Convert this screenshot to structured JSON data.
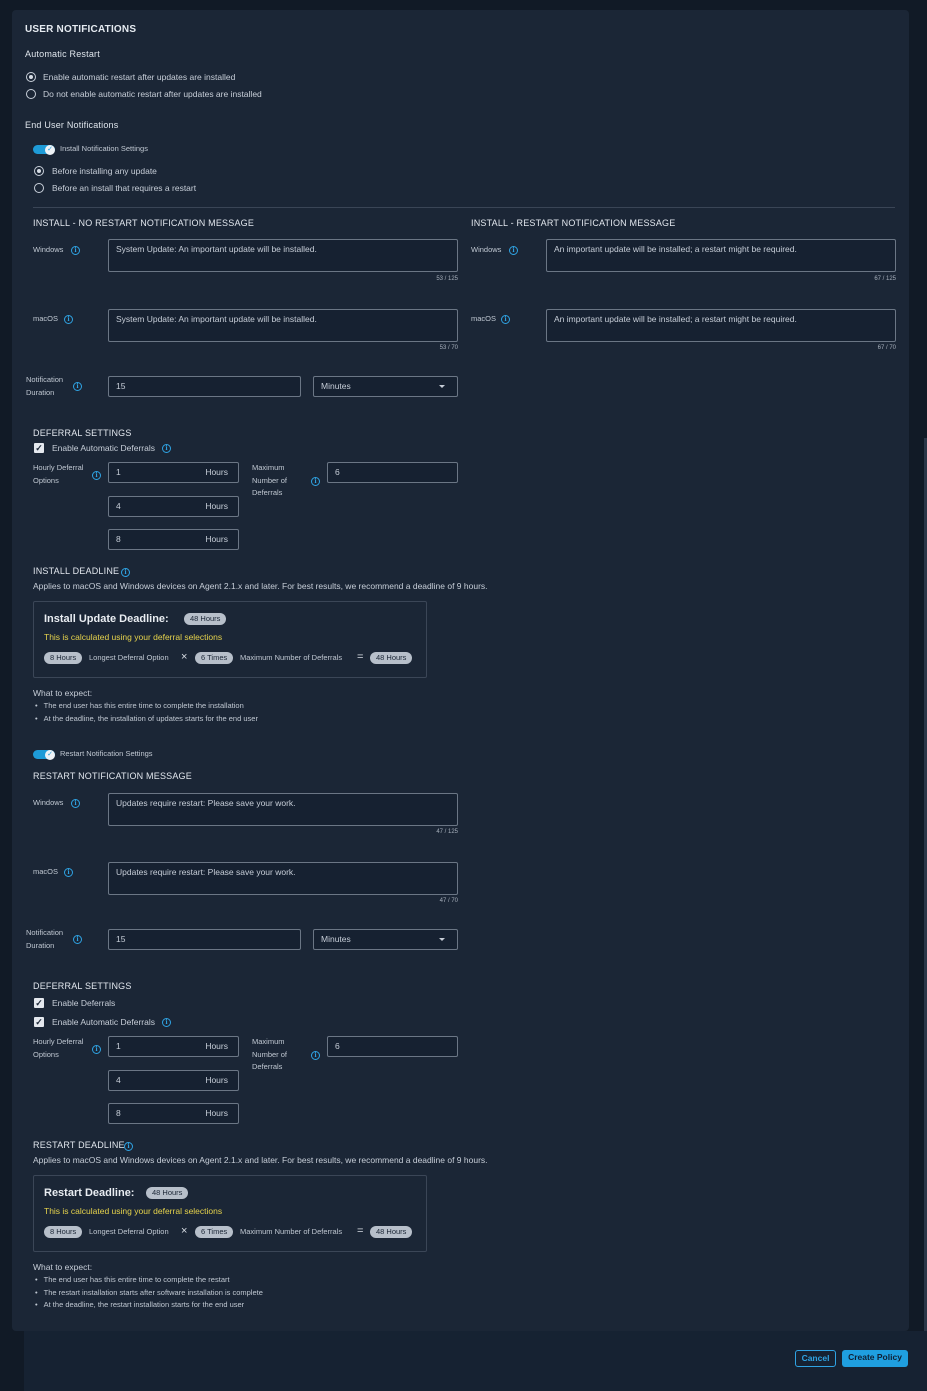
{
  "title": "USER NOTIFICATIONS",
  "automatic_restart": {
    "heading": "Automatic Restart",
    "options": [
      "Enable automatic restart after updates are installed",
      "Do not enable automatic restart after updates are installed"
    ],
    "selected_index": 0
  },
  "end_user": {
    "heading": "End User Notifications",
    "install_toggle_label": "Install Notification Settings",
    "install_toggle_on": true,
    "options": [
      "Before installing any update",
      "Before an install that requires a restart"
    ],
    "selected_index": 0
  },
  "install_messages": {
    "no_restart_heading": "INSTALL - NO RESTART NOTIFICATION MESSAGE",
    "restart_heading": "INSTALL - RESTART NOTIFICATION MESSAGE",
    "windows_label": "Windows",
    "macos_label": "macOS",
    "no_restart_windows": "System Update: An important update will be installed.",
    "no_restart_windows_count": "53 / 125",
    "no_restart_macos": "System Update: An important update will be installed.",
    "no_restart_macos_count": "53 / 70",
    "restart_windows": "An important update will be installed; a restart might be required.",
    "restart_windows_count": "67 / 125",
    "restart_macos": "An important update will be installed; a restart might be required.",
    "restart_macos_count": "67 / 70"
  },
  "install_duration": {
    "label_line1": "Notification",
    "label_line2": "Duration",
    "value": "15",
    "unit": "Minutes"
  },
  "install_deferral": {
    "heading": "DEFERRAL SETTINGS",
    "auto_label": "Enable Automatic Deferrals",
    "hourly_label_line1": "Hourly Deferral",
    "hourly_label_line2": "Options",
    "hours": [
      "1",
      "4",
      "8"
    ],
    "hours_unit": "Hours",
    "max_label_line1": "Maximum",
    "max_label_line2": "Number of",
    "max_label_line3": "Deferrals",
    "max_value": "6"
  },
  "install_deadline": {
    "heading": "INSTALL DEADLINE",
    "description": "Applies to macOS and Windows devices on Agent 2.1.x and later. For best results, we recommend a deadline of 9 hours.",
    "card_title": "Install Update Deadline:",
    "card_badge": "48 Hours",
    "calc_note": "This is calculated using your deferral selections",
    "pill1": "8 Hours",
    "pill1_label": "Longest Deferral Option",
    "times": "×",
    "pill2": "6 Times",
    "pill2_label": "Maximum Number of Deferrals",
    "equals": "=",
    "pill3": "48 Hours",
    "expect_heading": "What to expect:",
    "expect": [
      "The end user has this entire time to complete the installation",
      "At the deadline, the installation of updates starts for the end user"
    ]
  },
  "restart_section": {
    "toggle_label": "Restart Notification Settings",
    "toggle_on": true,
    "heading": "RESTART NOTIFICATION MESSAGE",
    "windows_label": "Windows",
    "macos_label": "macOS",
    "windows": "Updates require restart: Please save your work.",
    "windows_count": "47 / 125",
    "macos": "Updates require restart: Please save your work.",
    "macos_count": "47 / 70",
    "duration_label_line1": "Notification",
    "duration_label_line2": "Duration",
    "duration_value": "15",
    "duration_unit": "Minutes"
  },
  "restart_deferral": {
    "heading": "DEFERRAL SETTINGS",
    "enable_label": "Enable Deferrals",
    "auto_label": "Enable Automatic Deferrals",
    "hourly_label_line1": "Hourly Deferral",
    "hourly_label_line2": "Options",
    "hours": [
      "1",
      "4",
      "8"
    ],
    "hours_unit": "Hours",
    "max_label_line1": "Maximum",
    "max_label_line2": "Number of",
    "max_label_line3": "Deferrals",
    "max_value": "6"
  },
  "restart_deadline": {
    "heading": "RESTART DEADLINE",
    "description": "Applies to macOS and Windows devices on Agent 2.1.x and later. For best results, we recommend a deadline of 9 hours.",
    "card_title": "Restart Deadline:",
    "card_badge": "48 Hours",
    "calc_note": "This is calculated using your deferral selections",
    "pill1": "8 Hours",
    "pill1_label": "Longest Deferral Option",
    "times": "×",
    "pill2": "6 Times",
    "pill2_label": "Maximum Number of Deferrals",
    "equals": "=",
    "pill3": "48 Hours",
    "expect_heading": "What to expect:",
    "expect": [
      "The end user has this entire time to complete the restart",
      "The restart installation starts after software installation is complete",
      "At the deadline, the restart installation starts for the end user"
    ]
  },
  "footer": {
    "cancel": "Cancel",
    "create": "Create Policy"
  },
  "colors": {
    "accent": "#1f9fe0",
    "background": "#1b2636",
    "note": "#e6d34c"
  }
}
